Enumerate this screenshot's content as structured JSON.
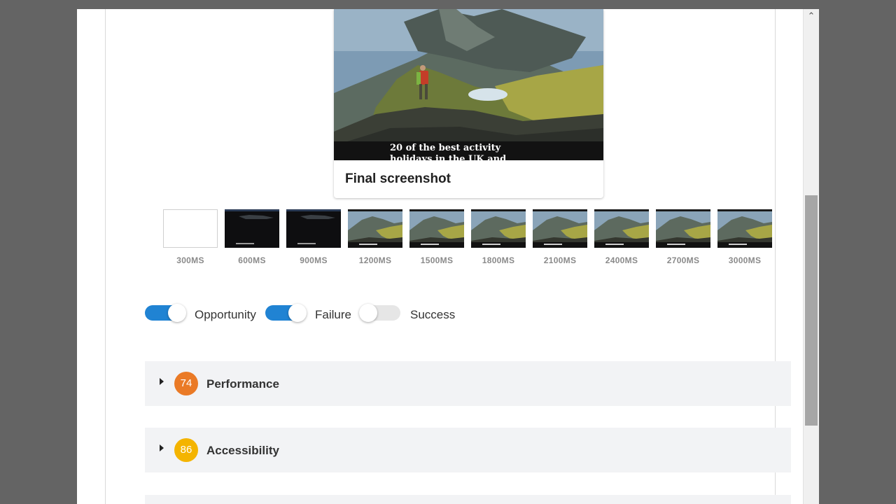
{
  "final_screenshot": {
    "label": "Final screenshot",
    "image_caption_line1": "20 of the best activity",
    "image_caption_line2": "holidays in the UK and"
  },
  "filmstrip": {
    "frames": [
      {
        "time": "300MS",
        "state": "blank"
      },
      {
        "time": "600MS",
        "state": "dark"
      },
      {
        "time": "900MS",
        "state": "dark"
      },
      {
        "time": "1200MS",
        "state": "loaded"
      },
      {
        "time": "1500MS",
        "state": "loaded"
      },
      {
        "time": "1800MS",
        "state": "loaded"
      },
      {
        "time": "2100MS",
        "state": "loaded"
      },
      {
        "time": "2400MS",
        "state": "loaded"
      },
      {
        "time": "2700MS",
        "state": "loaded"
      },
      {
        "time": "3000MS",
        "state": "loaded"
      }
    ]
  },
  "filters": {
    "opportunity": {
      "label": "Opportunity",
      "on": true
    },
    "failure": {
      "label": "Failure",
      "on": true
    },
    "success": {
      "label": "Success",
      "on": false
    }
  },
  "categories": [
    {
      "title": "Performance",
      "score": "74",
      "color": "#ea7a26"
    },
    {
      "title": "Accessibility",
      "score": "86",
      "color": "#f4b400"
    }
  ],
  "colors": {
    "toggle_on": "#2083d3",
    "toggle_off": "#e6e6e6"
  },
  "icons": {
    "scroll_up": "chevron-up-icon",
    "expand": "caret-right-icon"
  }
}
